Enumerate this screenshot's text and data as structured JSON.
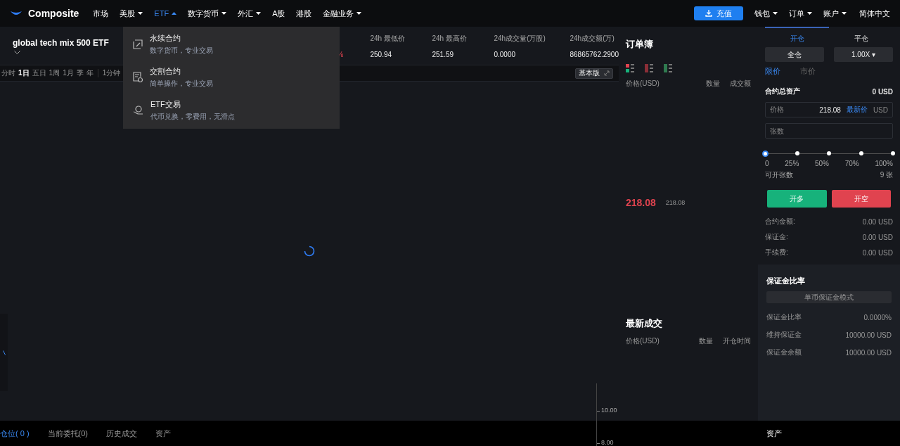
{
  "nav": {
    "logo": "Composite",
    "items": [
      {
        "label": "市场",
        "dropdown": false,
        "selected": false
      },
      {
        "label": "美股",
        "dropdown": true,
        "selected": false
      },
      {
        "label": "ETF",
        "dropdown": true,
        "selected": true,
        "expanded": true,
        "menu": [
          {
            "kind": "perpetual",
            "title": "永续合约",
            "desc": "数字货币，专业交易"
          },
          {
            "kind": "delivery",
            "title": "交割合约",
            "desc": "简单操作，专业交易"
          },
          {
            "kind": "etf",
            "title": "ETF交易",
            "desc": "代币兑换，零费用，无滑点"
          }
        ]
      },
      {
        "label": "数字货币",
        "dropdown": true,
        "selected": false
      },
      {
        "label": "外汇",
        "dropdown": true,
        "selected": false
      },
      {
        "label": "A股",
        "dropdown": false,
        "selected": false
      },
      {
        "label": "港股",
        "dropdown": false,
        "selected": false
      },
      {
        "label": "金融业务",
        "dropdown": true,
        "selected": false
      }
    ],
    "deposit": "充值",
    "right_items": [
      {
        "label": "钱包",
        "dropdown": true
      },
      {
        "label": "订单",
        "dropdown": true
      },
      {
        "label": "账户",
        "dropdown": true
      }
    ],
    "language": "简体中文"
  },
  "ticker": {
    "name": "global tech mix 500 ETF",
    "change": "%",
    "stats": [
      {
        "label": "24h 最低价",
        "value": "250.94"
      },
      {
        "label": "24h 最高价",
        "value": "251.59"
      },
      {
        "label": "24h成交量(万股)",
        "value": "0.0000"
      },
      {
        "label": "24h成交额(万)",
        "value": "86865762.2900"
      }
    ]
  },
  "chart_toolbar": {
    "periods": [
      {
        "label": "分时",
        "selected": false
      },
      {
        "label": "1日",
        "selected": true
      },
      {
        "label": "五日",
        "selected": false
      },
      {
        "label": "1周",
        "selected": false
      },
      {
        "label": "1月",
        "selected": false
      },
      {
        "label": "季",
        "selected": false
      },
      {
        "label": "年",
        "selected": false
      }
    ],
    "interval": "1分钟",
    "version_button": "基本版"
  },
  "price_axis": [
    "10.00",
    "8.00"
  ],
  "bottom_tabs": [
    {
      "label": "仓位( 0 )",
      "selected": true
    },
    {
      "label": "当前委托(0)",
      "selected": false
    },
    {
      "label": "历史成交",
      "selected": false
    },
    {
      "label": "资产",
      "selected": false
    }
  ],
  "order_book": {
    "title": "订单簿",
    "columns": [
      "价格(USD)",
      "数量",
      "成交额"
    ],
    "last_price": "218.08",
    "mark_price": "218.08"
  },
  "trades": {
    "title": "最新成交",
    "columns": [
      "价格(USD)",
      "数量",
      "开仓时间"
    ]
  },
  "trade_panel": {
    "tabs": [
      {
        "label": "开仓",
        "selected": true
      },
      {
        "label": "平仓",
        "selected": false
      }
    ],
    "margin_mode": "全仓",
    "leverage": "1.00X ▾",
    "order_types": [
      {
        "label": "限价",
        "selected": true
      },
      {
        "label": "市价",
        "selected": false
      }
    ],
    "total_assets_label": "合约总资产",
    "total_assets": "0 USD",
    "price_field": {
      "label": "价格",
      "value": "218.08",
      "link": "最新价",
      "unit": "USD"
    },
    "quantity_field": {
      "placeholder": "张数"
    },
    "slider": {
      "level": 0,
      "marks": [
        "0",
        "25%",
        "50%",
        "70%",
        "100%"
      ]
    },
    "available_label": "可开张数",
    "available": "9 张",
    "buy_button": "开多",
    "sell_button": "开空",
    "summary": [
      {
        "label": "合约金额:",
        "value": "0.00 USD"
      },
      {
        "label": "保证金:",
        "value": "0.00 USD"
      },
      {
        "label": "手续费:",
        "value": "0.00 USD"
      }
    ]
  },
  "margin": {
    "title": "保证金比率",
    "mode_button": "单币保证金模式",
    "rows": [
      {
        "label": "保证金比率",
        "value": "0.0000%"
      },
      {
        "label": "维持保证金",
        "value": "10000.00 USD"
      },
      {
        "label": "保证金余额",
        "value": "10000.00 USD"
      }
    ]
  },
  "assets_tab": "资产"
}
